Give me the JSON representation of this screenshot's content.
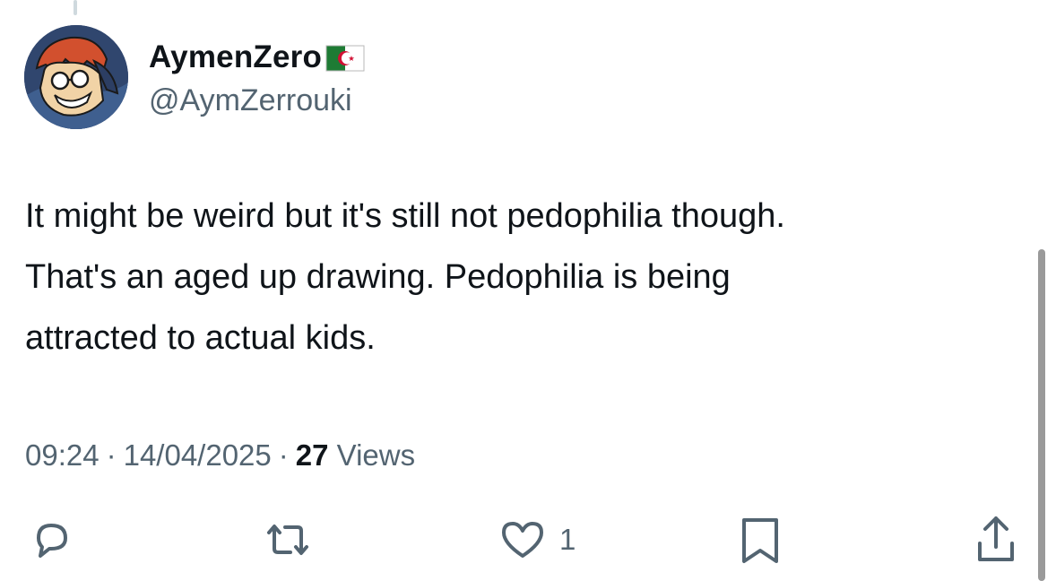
{
  "author": {
    "display_name": "AymenZero",
    "flag_icon": "algeria-flag-icon",
    "handle": "@AymZerrouki"
  },
  "tweet": {
    "lines": [
      "It might be weird but it's still not pedophilia though.",
      "That's an aged up drawing. Pedophilia is being",
      "attracted to actual kids."
    ]
  },
  "meta": {
    "time": "09:24",
    "separator": "·",
    "date": "14/04/2025",
    "views_count": "27",
    "views_label": "Views"
  },
  "actions": {
    "reply_icon": "reply-icon",
    "retweet_icon": "retweet-icon",
    "like_icon": "heart-icon",
    "like_count": "1",
    "bookmark_icon": "bookmark-icon",
    "share_icon": "share-icon"
  },
  "colors": {
    "text_primary": "#0f1419",
    "text_secondary": "#536471",
    "icon": "#536471"
  }
}
